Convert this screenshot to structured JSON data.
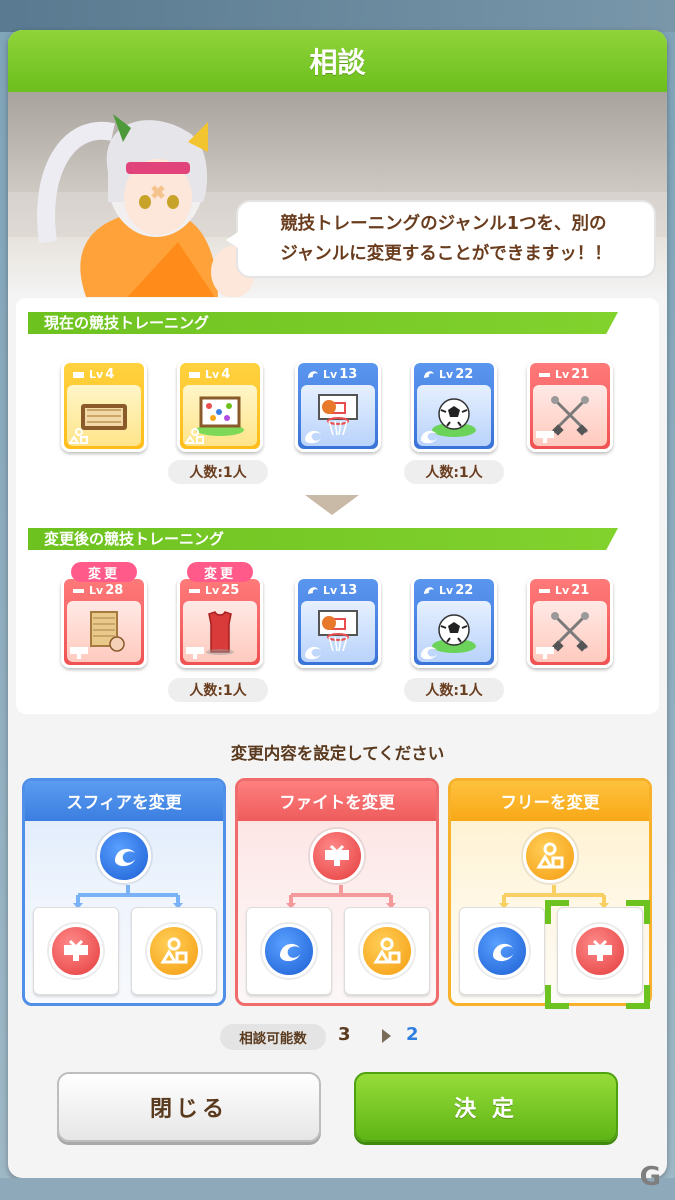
{
  "dialog": {
    "title": "相談",
    "message_line1": "競技トレーニングのジャンル1つを、別の",
    "message_line2": "ジャンルに変更することができますッ！！"
  },
  "current": {
    "section_title": "現在の競技トレーニング",
    "cards": [
      {
        "color": "yellow",
        "lv_label": "Lv",
        "lv": "4",
        "icon": "book-board-icon",
        "corner": "shapes-icon"
      },
      {
        "color": "yellow",
        "lv_label": "Lv",
        "lv": "4",
        "icon": "painting-board-icon",
        "corner": "shapes-icon"
      },
      {
        "color": "blue",
        "lv_label": "Lv",
        "lv": "13",
        "icon": "basketball-hoop-icon",
        "corner": "sphere-icon"
      },
      {
        "color": "blue",
        "lv_label": "Lv",
        "lv": "22",
        "icon": "soccer-ball-icon",
        "corner": "sphere-icon"
      },
      {
        "color": "red",
        "lv_label": "Lv",
        "lv": "21",
        "icon": "fencing-swords-icon",
        "corner": "fight-icon"
      }
    ],
    "counts": [
      "人数:1人",
      "人数:1人"
    ]
  },
  "after": {
    "section_title": "変更後の競技トレーニング",
    "changed_tag": "変更",
    "cards": [
      {
        "color": "red",
        "lv_label": "Lv",
        "lv": "28",
        "icon": "punching-board-icon",
        "corner": "fight-icon",
        "changed": true
      },
      {
        "color": "red",
        "lv_label": "Lv",
        "lv": "25",
        "icon": "jersey-icon",
        "corner": "fight-icon",
        "changed": true
      },
      {
        "color": "blue",
        "lv_label": "Lv",
        "lv": "13",
        "icon": "basketball-hoop-icon",
        "corner": "sphere-icon"
      },
      {
        "color": "blue",
        "lv_label": "Lv",
        "lv": "22",
        "icon": "soccer-ball-icon",
        "corner": "sphere-icon"
      },
      {
        "color": "red",
        "lv_label": "Lv",
        "lv": "21",
        "icon": "fencing-swords-icon",
        "corner": "fight-icon"
      }
    ],
    "counts": [
      "人数:1人",
      "人数:1人"
    ]
  },
  "instruction": "変更内容を設定してください",
  "options": [
    {
      "label": "スフィアを変更",
      "color": "blue"
    },
    {
      "label": "ファイトを変更",
      "color": "red"
    },
    {
      "label": "フリーを変更",
      "color": "orange"
    }
  ],
  "consult": {
    "label": "相談可能数",
    "before": "3",
    "after": "2"
  },
  "buttons": {
    "close": "閉じる",
    "confirm": "決 定"
  },
  "colors": {
    "accent_green": "#6cbf1d",
    "sphere_blue": "#3b7ee0",
    "fight_red": "#ee5c5c",
    "free_orange": "#f8a817"
  }
}
